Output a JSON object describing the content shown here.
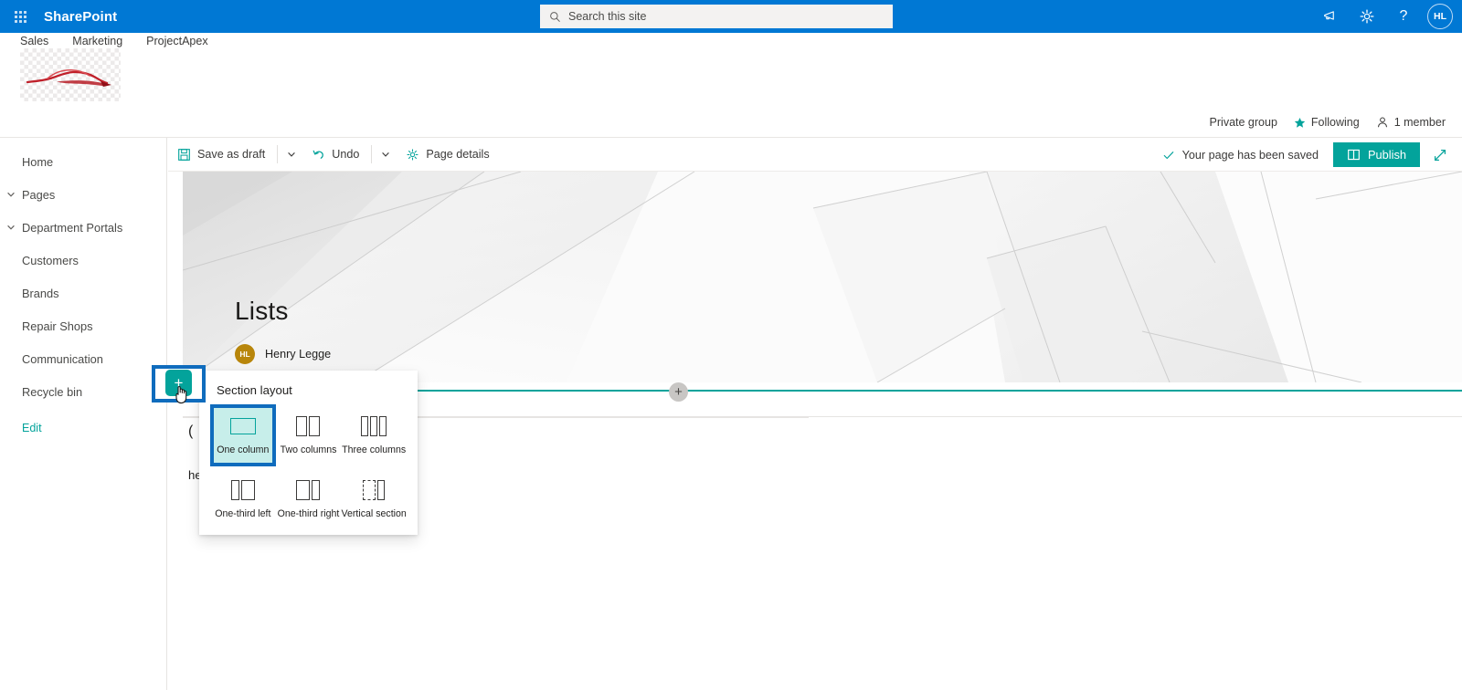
{
  "suite": {
    "waffle_icon": "app-launcher-waffle-icon",
    "brand": "SharePoint",
    "search": {
      "placeholder": "Search this site",
      "icon": "search-icon",
      "value": ""
    },
    "actions": [
      {
        "name": "megaphone-icon",
        "label": ""
      },
      {
        "name": "gear-icon",
        "label": ""
      },
      {
        "name": "help-icon",
        "label": "?"
      }
    ],
    "avatar": {
      "initials": "HL",
      "color": "#0078d4"
    },
    "bar_color": "#0078d4"
  },
  "site": {
    "nav_tabs": [
      "Sales",
      "Marketing",
      "ProjectApex"
    ],
    "logo_name": "site-logo-car-image",
    "info": {
      "privacy": "Private group",
      "following": "Following",
      "following_icon": "star-icon",
      "members": "1 member",
      "members_icon": "person-icon"
    }
  },
  "left_nav": {
    "items": [
      {
        "label": "Home",
        "chevron": false
      },
      {
        "label": "Pages",
        "chevron": true
      },
      {
        "label": "Department Portals",
        "chevron": true
      },
      {
        "label": "Customers",
        "chevron": false
      },
      {
        "label": "Brands",
        "chevron": false
      },
      {
        "label": "Repair Shops",
        "chevron": false
      },
      {
        "label": "Communication",
        "chevron": false
      },
      {
        "label": "Recycle bin",
        "chevron": false
      }
    ],
    "edit_label": "Edit"
  },
  "command_bar": {
    "save_as_draft": "Save as draft",
    "save_icon": "save-icon",
    "undo": "Undo",
    "undo_icon": "undo-icon",
    "page_details": "Page details",
    "page_details_icon": "gear-icon",
    "saved_status": "Your page has been saved",
    "saved_icon": "checkmark-icon",
    "publish": "Publish",
    "publish_icon": "news-page-icon",
    "publish_color": "#03a39b",
    "expand_icon": "expand-diagonal-icon"
  },
  "page": {
    "title": "Lists",
    "author": "Henry Legge",
    "author_initials": "HL",
    "author_avatar_color": "#b8860b",
    "add_section_plus": "+",
    "add_circle_plus": "+",
    "background_text": "he page is published.",
    "background_heading": "("
  },
  "layout_callout": {
    "title": "Section layout",
    "selected": "One column",
    "options": [
      {
        "label": "One column",
        "icon": "one-column-icon",
        "columns": [
          26
        ]
      },
      {
        "label": "Two columns",
        "icon": "two-columns-icon",
        "columns": [
          12,
          12
        ]
      },
      {
        "label": "Three columns",
        "icon": "three-columns-icon",
        "columns": [
          8,
          8,
          8
        ]
      },
      {
        "label": "One-third left",
        "icon": "one-third-left-icon",
        "columns": [
          9,
          15
        ]
      },
      {
        "label": "One-third right",
        "icon": "one-third-right-icon",
        "columns": [
          15,
          9
        ]
      },
      {
        "label": "Vertical section",
        "icon": "vertical-section-icon",
        "columns": [
          14,
          8
        ]
      }
    ],
    "focus_color": "#0f6cbd",
    "selected_fill": "#c7eeea"
  }
}
